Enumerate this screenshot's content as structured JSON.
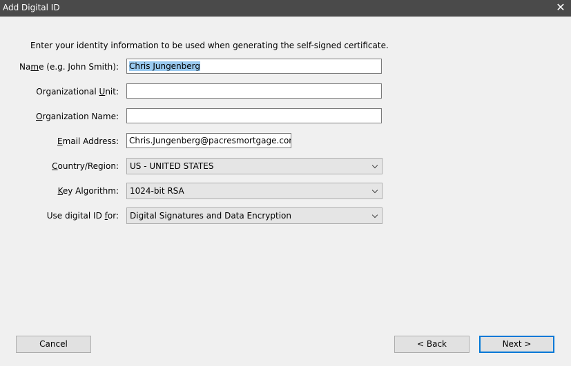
{
  "window": {
    "title": "Add Digital ID",
    "close_glyph": "✕"
  },
  "intro": "Enter your identity information to be used when generating the self-signed certificate.",
  "fields": {
    "name": {
      "label_pre": "Na",
      "label_u": "m",
      "label_post": "e (e.g. John Smith):",
      "value": "Chris Jungenberg"
    },
    "org_unit": {
      "label_pre": "Organizational ",
      "label_u": "U",
      "label_post": "nit:",
      "value": ""
    },
    "org_name": {
      "label_pre": "",
      "label_u": "O",
      "label_post": "rganization Name:",
      "value": ""
    },
    "email": {
      "label_pre": "",
      "label_u": "E",
      "label_post": "mail Address:",
      "value": "Chris.Jungenberg@pacresmortgage.com"
    },
    "country": {
      "label_pre": "",
      "label_u": "C",
      "label_post": "ountry/Region:",
      "value": "US - UNITED STATES"
    },
    "key_alg": {
      "label_pre": "",
      "label_u": "K",
      "label_post": "ey Algorithm:",
      "value": "1024-bit RSA"
    },
    "use_for": {
      "label_pre": "Use digital ID ",
      "label_u": "f",
      "label_post": "or:",
      "value": "Digital Signatures and Data Encryption"
    }
  },
  "buttons": {
    "cancel": "Cancel",
    "back": "< Back",
    "next": "Next >"
  },
  "colors": {
    "titlebar": "#4a4a4a",
    "selection": "#99c9ef",
    "default_button_border": "#0078d7"
  }
}
